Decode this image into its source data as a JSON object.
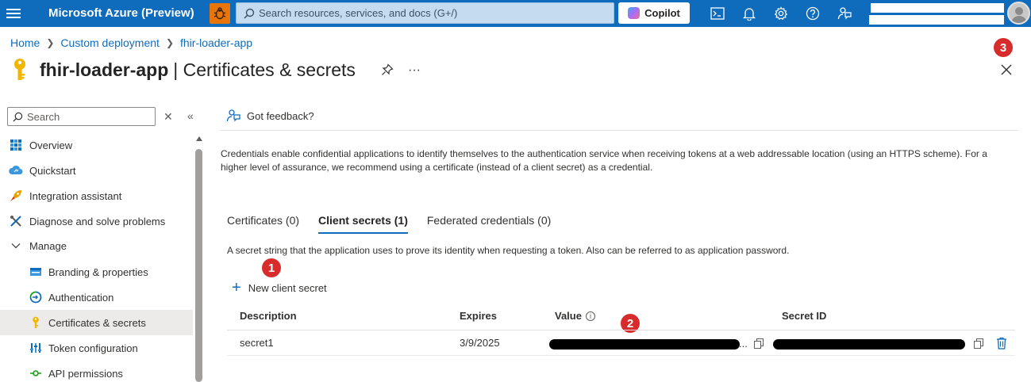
{
  "topbar": {
    "brand": "Microsoft Azure (Preview)",
    "search_placeholder": "Search resources, services, and docs (G+/)",
    "copilot_label": "Copilot",
    "icons": [
      "hamburger-icon",
      "bug-icon",
      "search-icon",
      "cloud-shell-icon",
      "bell-icon",
      "gear-icon",
      "help-icon",
      "feedback-icon",
      "avatar"
    ]
  },
  "breadcrumb": {
    "items": [
      "Home",
      "Custom deployment",
      "fhir-loader-app"
    ]
  },
  "title": {
    "main": "fhir-loader-app",
    "sub": "| Certificates & secrets",
    "more": "···"
  },
  "badges": {
    "one": "1",
    "two": "2",
    "three": "3"
  },
  "nav": {
    "search_placeholder": "Search",
    "items": [
      {
        "label": "Overview",
        "icon": "overview-icon"
      },
      {
        "label": "Quickstart",
        "icon": "quickstart-icon"
      },
      {
        "label": "Integration assistant",
        "icon": "rocket-icon"
      },
      {
        "label": "Diagnose and solve problems",
        "icon": "wrench-icon"
      },
      {
        "label": "Manage",
        "icon": "chevron-down-icon"
      },
      {
        "label": "Branding & properties",
        "icon": "branding-icon"
      },
      {
        "label": "Authentication",
        "icon": "authentication-icon"
      },
      {
        "label": "Certificates & secrets",
        "icon": "key-icon"
      },
      {
        "label": "Token configuration",
        "icon": "token-icon"
      },
      {
        "label": "API permissions",
        "icon": "api-permissions-icon"
      }
    ],
    "active": "Certificates & secrets"
  },
  "content": {
    "feedback_label": "Got feedback?",
    "description": "Credentials enable confidential applications to identify themselves to the authentication service when receiving tokens at a web addressable location (using an HTTPS scheme). For a higher level of assurance, we recommend using a certificate (instead of a client secret) as a credential.",
    "tabs": [
      "Certificates (0)",
      "Client secrets (1)",
      "Federated credentials (0)"
    ],
    "active_tab": "Client secrets (1)",
    "secret_description": "A secret string that the application uses to prove its identity when requesting a token. Also can be referred to as application password.",
    "new_secret_label": "New client secret",
    "table": {
      "headers": [
        "Description",
        "Expires",
        "Value",
        "Secret ID"
      ],
      "rows": [
        {
          "description": "secret1",
          "expires": "3/9/2025",
          "value_suffix": "...",
          "value": "[redacted]",
          "secret_id": "[redacted]"
        }
      ]
    }
  },
  "colors": {
    "topbar": "#0f6cbd",
    "accent": "#0f6cbd",
    "badge": "#d82b2b",
    "bug_button": "#e8740c"
  }
}
